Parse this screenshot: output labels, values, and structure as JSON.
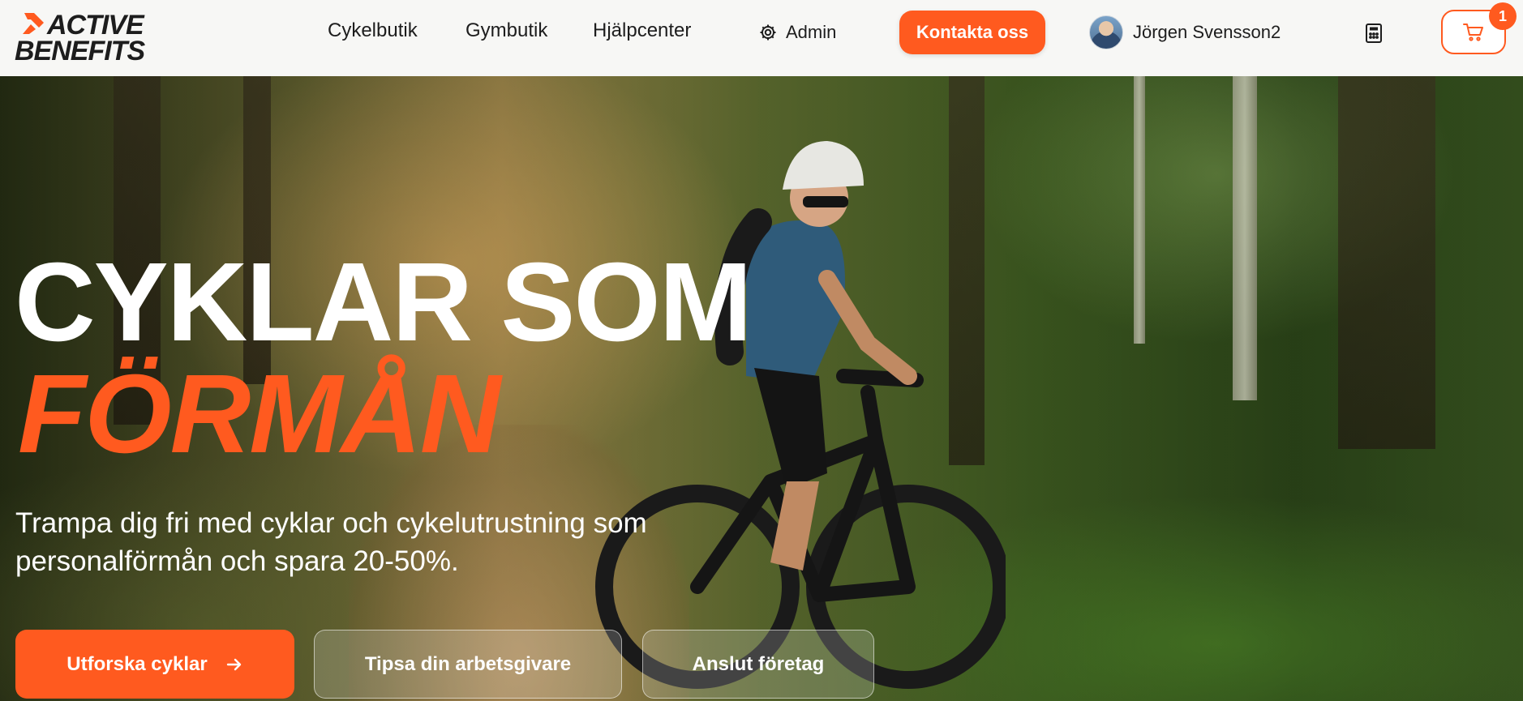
{
  "brand": {
    "logo_line1": "ACTIVE",
    "logo_line2": "BENEFITS",
    "accent_color": "#ff5a1f"
  },
  "nav": {
    "items": [
      {
        "label": "Cykelbutik"
      },
      {
        "label": "Gymbutik"
      },
      {
        "label": "Hjälpcenter"
      }
    ],
    "admin_label": "Admin",
    "admin_icon": "gear-icon",
    "contact_label": "Kontakta oss",
    "user_name": "Jörgen Svensson2",
    "calculator_icon": "calculator-icon",
    "cart_icon": "cart-icon",
    "cart_count": "1"
  },
  "hero": {
    "headline_line1": "CYKLAR SOM",
    "headline_line2": "FÖRMÅN",
    "subtitle_line1": "Trampa dig fri med cyklar och cykelutrustning som",
    "subtitle_line2": "personalförmån och spara 20-50%.",
    "primary_button": "Utforska cyklar",
    "primary_button_icon": "arrow-right-icon",
    "secondary_button": "Tipsa din arbetsgivare",
    "tertiary_button": "Anslut företag"
  }
}
